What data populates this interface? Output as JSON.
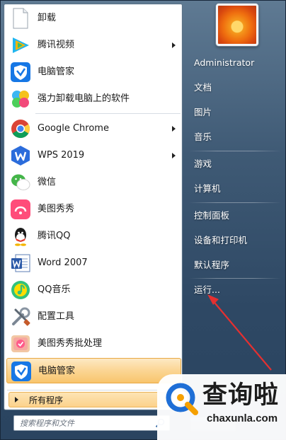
{
  "left_menu": {
    "items": [
      {
        "label": "卸载",
        "icon": "document-icon",
        "arrow": false
      },
      {
        "label": "腾讯视频",
        "icon": "tencent-video-icon",
        "arrow": true
      },
      {
        "label": "电脑管家",
        "icon": "pc-manager-icon",
        "arrow": false
      },
      {
        "label": "强力卸载电脑上的软件",
        "icon": "uninstaller-icon",
        "arrow": false
      },
      {
        "label": "Google Chrome",
        "icon": "chrome-icon",
        "arrow": true
      },
      {
        "label": "WPS 2019",
        "icon": "wps-icon",
        "arrow": true
      },
      {
        "label": "微信",
        "icon": "wechat-icon",
        "arrow": false
      },
      {
        "label": "美图秀秀",
        "icon": "meitu-icon",
        "arrow": false
      },
      {
        "label": "腾讯QQ",
        "icon": "qq-icon",
        "arrow": false
      },
      {
        "label": "Word 2007",
        "icon": "word-icon",
        "arrow": false
      },
      {
        "label": "QQ音乐",
        "icon": "qq-music-icon",
        "arrow": false
      },
      {
        "label": "配置工具",
        "icon": "config-tool-icon",
        "arrow": false
      },
      {
        "label": "美图秀秀批处理",
        "icon": "meitu-batch-icon",
        "arrow": false
      },
      {
        "label": "电脑管家",
        "icon": "pc-manager-icon",
        "arrow": false,
        "highlighted": true
      }
    ],
    "all_programs": "所有程序",
    "search_placeholder": "搜索程序和文件"
  },
  "right_menu": {
    "items": [
      "Administrator",
      "文档",
      "图片",
      "音乐",
      "游戏",
      "计算机",
      "控制面板",
      "设备和打印机",
      "默认程序",
      "运行..."
    ]
  },
  "watermark": {
    "title": "查询啦",
    "url": "chaxunla.com"
  },
  "colors": {
    "highlight": "#fbd593",
    "annotation_arrow": "#e53030"
  }
}
